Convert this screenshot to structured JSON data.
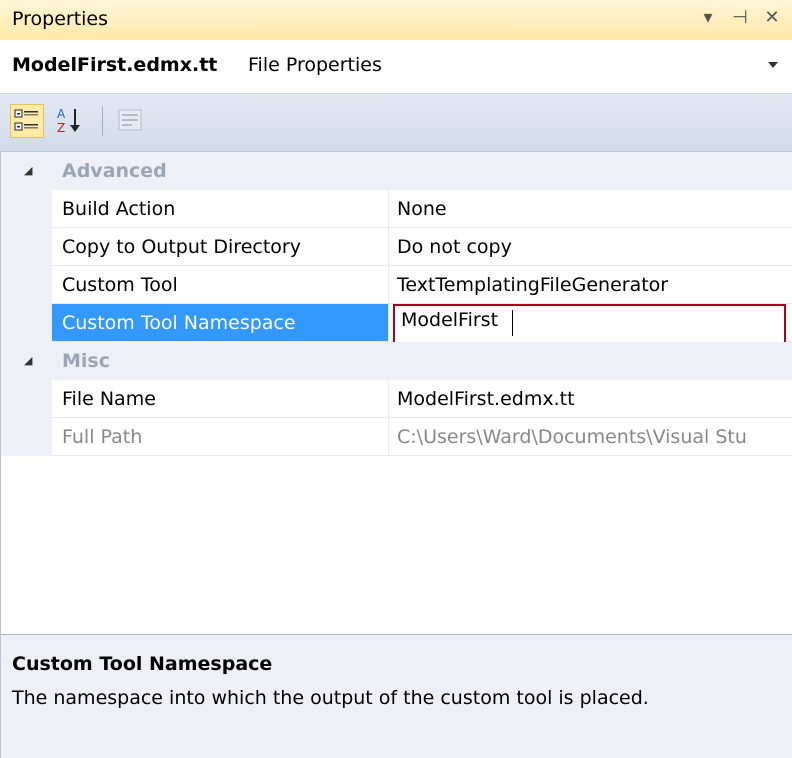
{
  "window": {
    "title": "Properties"
  },
  "object_selector": {
    "name": "ModelFirst.edmx.tt",
    "type": "File Properties"
  },
  "toolbar": {
    "categorized_icon": "categorized-icon",
    "alphabetical_icon": "alphabetical-icon",
    "property_pages_icon": "property-pages-icon"
  },
  "categories": [
    {
      "label": "Advanced",
      "properties": [
        {
          "name": "Build Action",
          "value": "None"
        },
        {
          "name": "Copy to Output Directory",
          "value": "Do not copy"
        },
        {
          "name": "Custom Tool",
          "value": "TextTemplatingFileGenerator"
        },
        {
          "name": "Custom Tool Namespace",
          "value": "ModelFirst"
        }
      ]
    },
    {
      "label": "Misc",
      "properties": [
        {
          "name": "File Name",
          "value": "ModelFirst.edmx.tt"
        },
        {
          "name": "Full Path",
          "value": "C:\\Users\\Ward\\Documents\\Visual Stu"
        }
      ]
    }
  ],
  "help": {
    "title": "Custom Tool Namespace",
    "description": "The namespace into which the output of the custom tool is placed."
  },
  "colors": {
    "title_bg": "#ffe9a8",
    "selection": "#3399ff",
    "edit_border": "#b00018",
    "gutter": "#edf1f7"
  }
}
